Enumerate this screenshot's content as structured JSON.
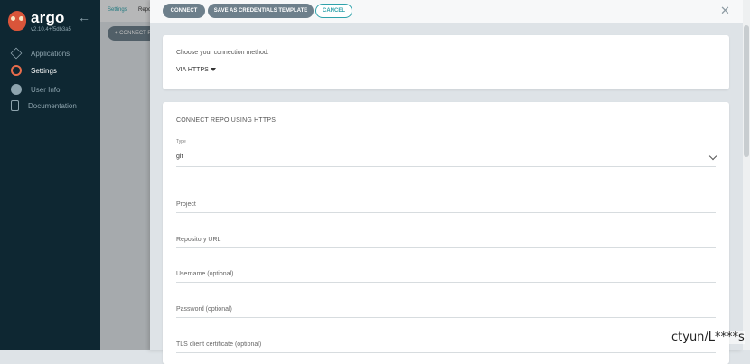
{
  "sidebar": {
    "app_name": "argo",
    "version": "v2.10.4+f5db3a5",
    "items": [
      {
        "label": "Applications",
        "icon": "applications-icon"
      },
      {
        "label": "Settings",
        "icon": "settings-icon"
      },
      {
        "label": "User Info",
        "icon": "user-icon"
      },
      {
        "label": "Documentation",
        "icon": "documentation-icon"
      }
    ]
  },
  "background_page": {
    "breadcrumb": [
      "Settings",
      "Repo"
    ],
    "connect_button": "+ CONNECT R"
  },
  "panel": {
    "buttons": {
      "connect": "CONNECT",
      "save_template": "SAVE AS CREDENTIALS TEMPLATE",
      "cancel": "CANCEL"
    },
    "close_icon": "close-icon",
    "method_label": "Choose your connection method:",
    "method_value": "VIA HTTPS",
    "form_title": "CONNECT REPO USING HTTPS",
    "type_label": "Type",
    "type_value": "git",
    "fields": {
      "project": "Project",
      "repo_url": "Repository URL",
      "username": "Username (optional)",
      "password": "Password (optional)",
      "tls_cert": "TLS client certificate (optional)"
    }
  },
  "watermark": "ctyun/L****s",
  "colors": {
    "sidebar_bg": "#0e2732",
    "accent": "#2fa2ab",
    "button_dark": "#6d7f8b",
    "settings_icon": "#e96d4c"
  }
}
